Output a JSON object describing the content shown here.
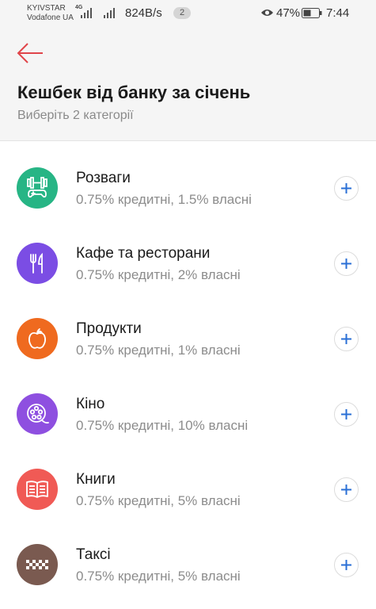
{
  "status_bar": {
    "carrier_1": "KYIVSTAR",
    "carrier_2": "Vodafone UA",
    "network_type": "4G",
    "speed": "824B/s",
    "notification_count": "2",
    "battery_percent": "47%",
    "time": "7:44"
  },
  "header": {
    "title": "Кешбек від банку за січень",
    "subtitle": "Виберіть 2 категорії",
    "accent_color": "#e0454a"
  },
  "categories": [
    {
      "name": "Розваги",
      "description": "0.75% кредитні, 1.5% власні",
      "icon": "gamepad-dumbbell-icon",
      "color": "#27b585"
    },
    {
      "name": "Кафе та ресторани",
      "description": "0.75% кредитні, 2% власні",
      "icon": "fork-knife-icon",
      "color": "#7b4de4"
    },
    {
      "name": "Продукти",
      "description": "0.75% кредитні, 1% власні",
      "icon": "apple-icon",
      "color": "#ef6a1f"
    },
    {
      "name": "Кіно",
      "description": "0.75% кредитні, 10% власні",
      "icon": "film-reel-icon",
      "color": "#8e4fe0"
    },
    {
      "name": "Книги",
      "description": "0.75% кредитні, 5% власні",
      "icon": "open-book-icon",
      "color": "#f05a55"
    },
    {
      "name": "Таксі",
      "description": "0.75% кредитні, 5% власні",
      "icon": "taxi-icon",
      "color": "#7a5a50"
    }
  ],
  "add_icon_color": "#2a6fd6"
}
